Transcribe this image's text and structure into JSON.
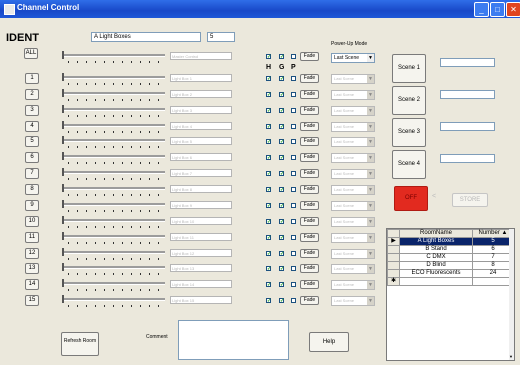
{
  "window": {
    "title": "Channel Control",
    "minimize": "_",
    "maximize": "□",
    "close": "✕"
  },
  "ident": {
    "label": "IDENT",
    "room_name": "A Light Boxes",
    "room_number": "5"
  },
  "all_label": "ALL",
  "header_checks": {
    "h": "H",
    "g": "G",
    "p": "P"
  },
  "powerup": {
    "label": "Power-Up Mode",
    "value": "Last Scene"
  },
  "master": {
    "name": "Master Control",
    "fade": "Fade"
  },
  "channels": [
    {
      "num": "1",
      "name": "Light Box 1",
      "mode": "Last Scene"
    },
    {
      "num": "2",
      "name": "Light Box 2",
      "mode": "Last Scene"
    },
    {
      "num": "3",
      "name": "Light Box 3",
      "mode": "Last Scene"
    },
    {
      "num": "4",
      "name": "Light Box 4",
      "mode": "Last Scene"
    },
    {
      "num": "5",
      "name": "Light Box 5",
      "mode": "Last Scene"
    },
    {
      "num": "6",
      "name": "Light Box 6",
      "mode": "Last Scene"
    },
    {
      "num": "7",
      "name": "Light Box 7",
      "mode": "Last Scene"
    },
    {
      "num": "8",
      "name": "Light Box 8",
      "mode": "Last Scene"
    },
    {
      "num": "9",
      "name": "Light Box 9",
      "mode": "Last Scene"
    },
    {
      "num": "10",
      "name": "Light Box 10",
      "mode": "Last Scene"
    },
    {
      "num": "11",
      "name": "Light Box 11",
      "mode": "Last Scene"
    },
    {
      "num": "12",
      "name": "Light Box 12",
      "mode": "Last Scene"
    },
    {
      "num": "13",
      "name": "Light Box 13",
      "mode": "Last Scene"
    },
    {
      "num": "14",
      "name": "Light Box 14",
      "mode": "Last Scene"
    },
    {
      "num": "15",
      "name": "Light Box 15",
      "mode": "Last Scene"
    }
  ],
  "fade_label": "Fade",
  "scenes": [
    {
      "label": "Scene 1",
      "value": ""
    },
    {
      "label": "Scene 2",
      "value": ""
    },
    {
      "label": "Scene 3",
      "value": ""
    },
    {
      "label": "Scene 4",
      "value": ""
    }
  ],
  "off_button": "OFF",
  "store_button": "STORE",
  "arrow_glyph": "<",
  "rooms_table": {
    "headers": [
      "RoomName",
      "Number"
    ],
    "rows": [
      {
        "name": "A Light Boxes",
        "number": "5"
      },
      {
        "name": "B Stand",
        "number": "6"
      },
      {
        "name": "C DMX",
        "number": "7"
      },
      {
        "name": "D Blind",
        "number": "8"
      },
      {
        "name": "ECO Fluorescents",
        "number": "24"
      }
    ],
    "current_marker": "▶",
    "new_marker": "✱"
  },
  "refresh_button": "Refresh Room",
  "comment_label": "Comment",
  "comment_value": "",
  "help_button": "Help",
  "colors": {
    "titlebar": "#1e58d8",
    "off_red": "#e22a1f",
    "selection": "#0a246a"
  }
}
